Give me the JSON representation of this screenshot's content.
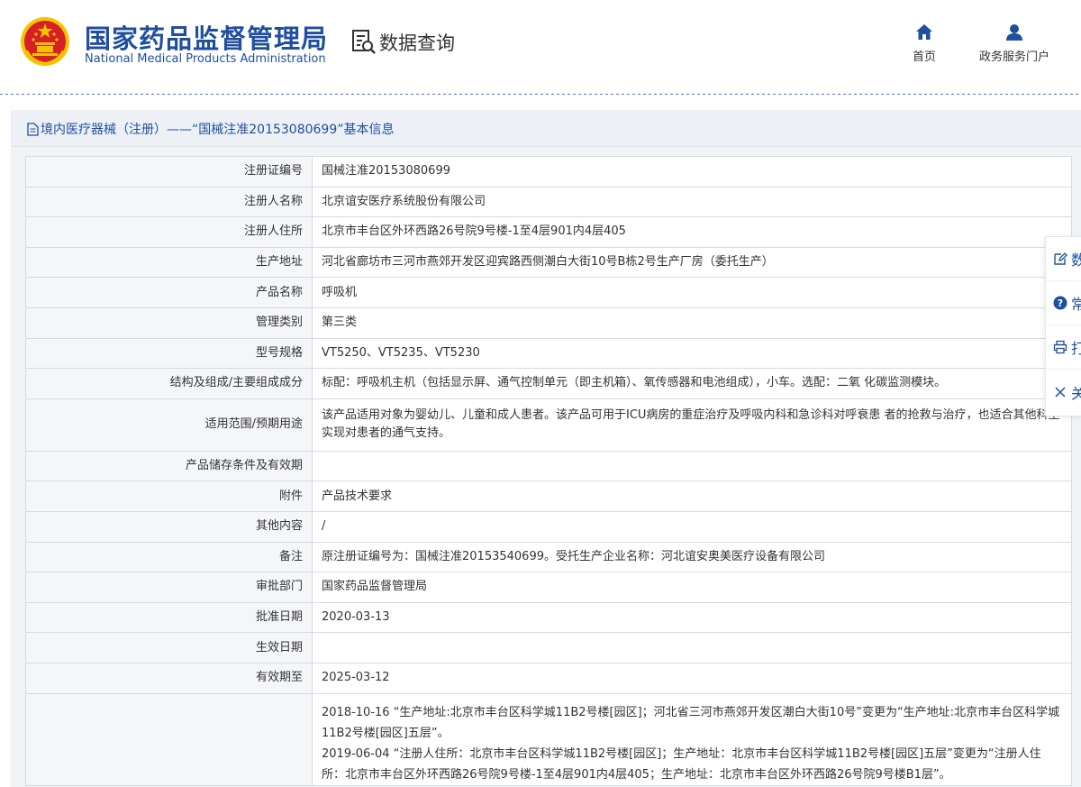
{
  "header": {
    "logo_cn": "国家药品监督管理局",
    "logo_en": "National Medical Products Administration",
    "data_query": "数据查询",
    "nav": [
      {
        "label": "首页"
      },
      {
        "label": "政务服务门户"
      }
    ]
  },
  "page_title": "境内医疗器械（注册）——“国械注准20153080699”基本信息",
  "rows": [
    {
      "label": "注册证编号",
      "value": "国械注准20153080699"
    },
    {
      "label": "注册人名称",
      "value": "北京谊安医疗系统股份有限公司"
    },
    {
      "label": "注册人住所",
      "value": "北京市丰台区外环西路26号院9号楼-1至4层901内4层405"
    },
    {
      "label": "生产地址",
      "value": "河北省廊坊市三河市燕郊开发区迎宾路西侧潮白大街10号B栋2号生产厂房（委托生产）"
    },
    {
      "label": "产品名称",
      "value": "呼吸机"
    },
    {
      "label": "管理类别",
      "value": "第三类"
    },
    {
      "label": "型号规格",
      "value": "VT5250、VT5235、VT5230"
    },
    {
      "label": "结构及组成/主要组成成分",
      "value": "标配：呼吸机主机（包括显示屏、通气控制单元（即主机箱）、氧传感器和电池组成），小车。选配：二氧 化碳监测模块。"
    },
    {
      "label": "适用范围/预期用途",
      "value": "该产品适用对象为婴幼儿、儿童和成人患者。该产品可用于ICU病房的重症治疗及呼吸内科和急诊科对呼衰患 者的抢救与治疗，也适合其他科室实现对患者的通气支持。"
    },
    {
      "label": "产品储存条件及有效期",
      "value": ""
    },
    {
      "label": "附件",
      "value": "产品技术要求"
    },
    {
      "label": "其他内容",
      "value": "/"
    },
    {
      "label": "备注",
      "value": "原注册证编号为：国械注准20153540699。受托生产企业名称：河北谊安奥美医疗设备有限公司"
    },
    {
      "label": "审批部门",
      "value": "国家药品监督管理局"
    },
    {
      "label": "批准日期",
      "value": "2020-03-13"
    },
    {
      "label": "生效日期",
      "value": ""
    },
    {
      "label": "有效期至",
      "value": "2025-03-12"
    }
  ],
  "changes": [
    "2018-10-16 “生产地址:北京市丰台区科学城11B2号楼[园区]；河北省三河市燕郊开发区潮白大街10号”变更为“生产地址:北京市丰台区科学城11B2号楼[园区]五层”。",
    "2019-06-04 “注册人住所：北京市丰台区科学城11B2号楼[园区]；生产地址：北京市丰台区科学城11B2号楼[园区]五层”变更为“注册人住所：北京市丰台区外环西路26号院9号楼-1至4层901内4层405；生产地址：北京市丰台区外环西路26号院9号楼B1层”。"
  ],
  "toolbar": [
    {
      "label": "数",
      "icon": "edit-icon"
    },
    {
      "label": "常",
      "icon": "question-icon"
    },
    {
      "label": "打",
      "icon": "print-icon"
    },
    {
      "label": "关",
      "icon": "close-icon"
    }
  ],
  "colors": {
    "brand": "#1f4f9e",
    "emblem_red": "#d71f26",
    "emblem_gold": "#f5c400"
  }
}
